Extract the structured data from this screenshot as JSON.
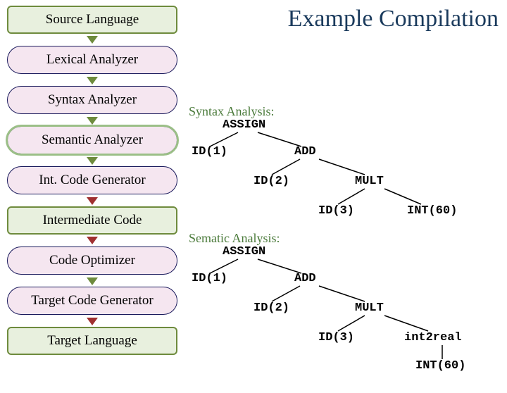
{
  "title": "Example Compilation",
  "stages": [
    {
      "label": "Source Language",
      "kind": "rect-green",
      "arrow": "green"
    },
    {
      "label": "Lexical Analyzer",
      "kind": "pill-pink",
      "arrow": "green"
    },
    {
      "label": "Syntax Analyzer",
      "kind": "pill-pink",
      "arrow": "green"
    },
    {
      "label": "Semantic Analyzer",
      "kind": "pill-pink thick",
      "arrow": "green"
    },
    {
      "label": "Int. Code Generator",
      "kind": "pill-pink",
      "arrow": "red"
    },
    {
      "label": "Intermediate Code",
      "kind": "rect-green",
      "arrow": "red"
    },
    {
      "label": "Code Optimizer",
      "kind": "pill-pink",
      "arrow": "green"
    },
    {
      "label": "Target Code Generator",
      "kind": "pill-pink",
      "arrow": "red"
    },
    {
      "label": "Target Language",
      "kind": "rect-green",
      "arrow": ""
    }
  ],
  "syntax_tree": {
    "label": "Syntax Analysis:",
    "root": "ASSIGN",
    "n_id1": "ID(1)",
    "n_add": "ADD",
    "n_id2": "ID(2)",
    "n_mult": "MULT",
    "n_id3": "ID(3)",
    "n_int60": "INT(60)"
  },
  "sematic_tree": {
    "label": "Sematic Analysis:",
    "root": "ASSIGN",
    "n_id1": "ID(1)",
    "n_add": "ADD",
    "n_id2": "ID(2)",
    "n_mult": "MULT",
    "n_id3": "ID(3)",
    "n_int2real": "int2real",
    "n_int60": "INT(60)"
  }
}
